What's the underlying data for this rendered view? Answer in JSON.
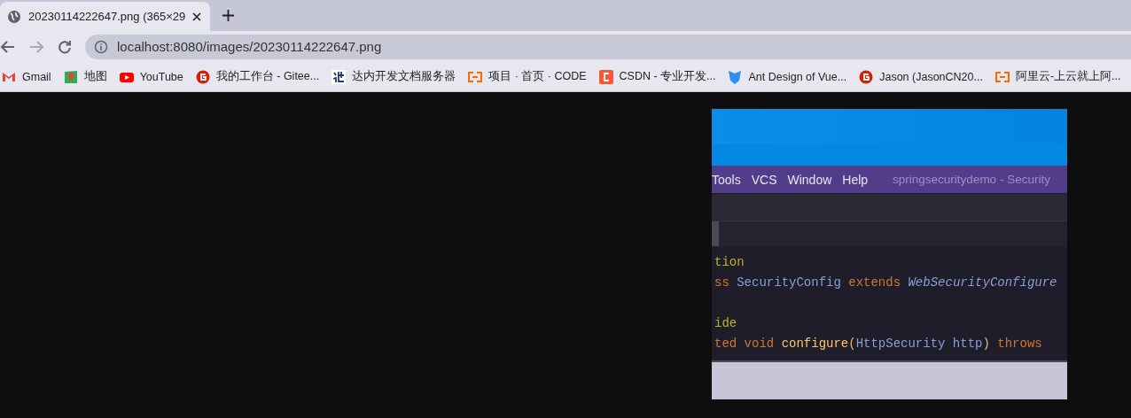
{
  "tabs": [
    {
      "title": "20230114222647.png (365×29",
      "selected": true
    }
  ],
  "toolbar": {
    "nav": [
      {
        "kind": "back",
        "disabled": false
      },
      {
        "kind": "forward",
        "disabled": true
      },
      {
        "kind": "reload",
        "disabled": false
      }
    ],
    "address": "localhost:8080/images/20230114222647.png"
  },
  "bookmarks": [
    {
      "label": "Gmail",
      "kind": "mail"
    },
    {
      "label": "地图",
      "kind": "pin"
    },
    {
      "label": "YouTube",
      "kind": "play"
    },
    {
      "label": "我的工作台 - Gitee...",
      "kind": "ring"
    },
    {
      "label": "达内开发文档服务器",
      "kind": "tile"
    },
    {
      "label": "项目 · 首页 · CODE",
      "kind": "bracket"
    },
    {
      "label": "CSDN - 专业开发...",
      "kind": "square"
    },
    {
      "label": "Ant Design of Vue...",
      "kind": "shield"
    },
    {
      "label": "Jason (JasonCN20...",
      "kind": "ring"
    },
    {
      "label": "阿里云-上云就上阿...",
      "kind": "bracket"
    }
  ],
  "image": {
    "menu": [
      "Tools",
      "VCS",
      "Window",
      "Help"
    ],
    "window_title": "springsecuritydemo - Security",
    "code_blocks": [
      {
        "lines": [
          [
            {
              "t": "tion",
              "kind": "annotation"
            }
          ],
          [
            {
              "t": "ss ",
              "kind": "keyword"
            },
            {
              "t": "SecurityConfig ",
              "kind": "type"
            },
            {
              "t": "extends ",
              "kind": "keyword"
            },
            {
              "t": "WebSecurityConfigure",
              "kind": "italic"
            }
          ]
        ]
      },
      {
        "lines": [
          [
            {
              "t": "ide",
              "kind": "annotation"
            }
          ],
          [
            {
              "t": "ted void ",
              "kind": "keyword"
            },
            {
              "t": "configure",
              "kind": "method"
            },
            {
              "t": "(",
              "kind": "paren"
            },
            {
              "t": "HttpSecurity http",
              "kind": "type"
            },
            {
              "t": ") ",
              "kind": "paren"
            },
            {
              "t": "throws",
              "kind": "keyword"
            }
          ]
        ]
      }
    ]
  }
}
